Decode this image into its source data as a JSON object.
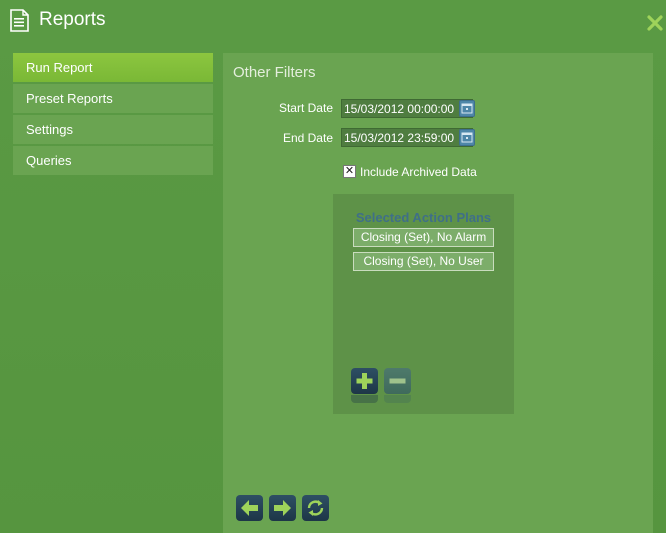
{
  "window": {
    "title": "Reports",
    "title_icon": "document-icon",
    "close_icon": "close-icon",
    "accent": "#8cc63f"
  },
  "sidebar": {
    "items": [
      {
        "label": "Run Report",
        "active": true
      },
      {
        "label": "Preset Reports",
        "active": false
      },
      {
        "label": "Settings",
        "active": false
      },
      {
        "label": "Queries",
        "active": false
      }
    ]
  },
  "filters": {
    "title": "Other Filters",
    "start_date_label": "Start Date",
    "start_date_value": "15/03/2012 00:00:00",
    "end_date_label": "End Date",
    "end_date_value": "15/03/2012 23:59:00",
    "include_archived_label": "Include Archived Data",
    "include_archived_checked": true
  },
  "action_plans": {
    "title": "Selected Action Plans",
    "items": [
      "Closing (Set), No Alarm",
      "Closing (Set), No User"
    ],
    "add_icon": "plus-icon",
    "remove_icon": "minus-icon"
  },
  "footer": {
    "back_icon": "arrow-left-icon",
    "next_icon": "arrow-right-icon",
    "refresh_icon": "refresh-icon"
  }
}
